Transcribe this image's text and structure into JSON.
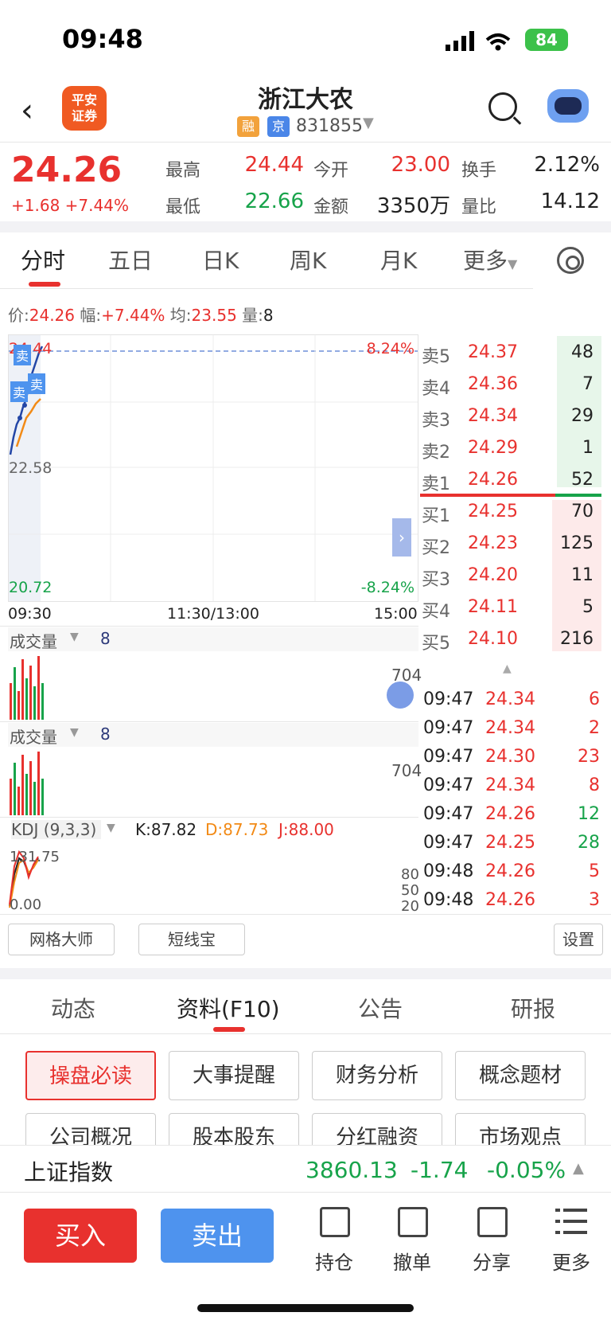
{
  "status": {
    "time": "09:48",
    "battery": "84"
  },
  "header": {
    "logo_line1": "平安",
    "logo_line2": "证券",
    "title": "浙江大农",
    "tag_rong": "融",
    "tag_jing": "京",
    "code": "831855"
  },
  "quote": {
    "price": "24.26",
    "change": "+1.68",
    "change_pct": "+7.44%",
    "high_label": "最高",
    "high": "24.44",
    "low_label": "最低",
    "low": "22.66",
    "open_label": "今开",
    "open": "23.00",
    "amount_label": "金额",
    "amount": "3350万",
    "turnover_label": "换手",
    "turnover": "2.12%",
    "ratio_label": "量比",
    "ratio": "14.12"
  },
  "tabs": [
    "分时",
    "五日",
    "日K",
    "周K",
    "月K",
    "更多"
  ],
  "infoline": {
    "price_label": "价:",
    "price": "24.26",
    "amp_label": "幅:",
    "amp": "+7.44%",
    "avg_label": "均:",
    "avg": "23.55",
    "vol_label": "量:",
    "vol": "8"
  },
  "chart": {
    "top_left": "24.44",
    "top_right": "8.24%",
    "mid_left": "22.58",
    "bottom_left": "20.72",
    "bottom_right": "-8.24%",
    "t_start": "09:30",
    "t_mid": "11:30/13:00",
    "t_end": "15:00",
    "sell_tag": "卖"
  },
  "order_book": {
    "asks": [
      {
        "label": "卖5",
        "price": "24.37",
        "vol": "48"
      },
      {
        "label": "卖4",
        "price": "24.36",
        "vol": "7"
      },
      {
        "label": "卖3",
        "price": "24.34",
        "vol": "29"
      },
      {
        "label": "卖2",
        "price": "24.29",
        "vol": "1"
      },
      {
        "label": "卖1",
        "price": "24.26",
        "vol": "52"
      }
    ],
    "bids": [
      {
        "label": "买1",
        "price": "24.25",
        "vol": "70"
      },
      {
        "label": "买2",
        "price": "24.23",
        "vol": "125"
      },
      {
        "label": "买3",
        "price": "24.20",
        "vol": "11"
      },
      {
        "label": "买4",
        "price": "24.11",
        "vol": "5"
      },
      {
        "label": "买5",
        "price": "24.10",
        "vol": "216"
      }
    ]
  },
  "ticks": [
    {
      "time": "09:47",
      "price": "24.34",
      "vol": "6",
      "dir": "up"
    },
    {
      "time": "09:47",
      "price": "24.34",
      "vol": "2",
      "dir": "up"
    },
    {
      "time": "09:47",
      "price": "24.30",
      "vol": "23",
      "dir": "up"
    },
    {
      "time": "09:47",
      "price": "24.34",
      "vol": "8",
      "dir": "up"
    },
    {
      "time": "09:47",
      "price": "24.26",
      "vol": "12",
      "dir": "down"
    },
    {
      "time": "09:47",
      "price": "24.25",
      "vol": "28",
      "dir": "down"
    },
    {
      "time": "09:48",
      "price": "24.26",
      "vol": "5",
      "dir": "up"
    },
    {
      "time": "09:48",
      "price": "24.26",
      "vol": "3",
      "dir": "up"
    }
  ],
  "volume1": {
    "label": "成交量",
    "value": "8",
    "max": "704"
  },
  "volume2": {
    "label": "成交量",
    "value": "8",
    "max": "704"
  },
  "kdj": {
    "label": "KDJ (9,3,3)",
    "k": "K:87.82",
    "d": "D:87.73",
    "j": "J:88.00",
    "top": "131.75",
    "bottom": "0.00",
    "l80": "80",
    "l50": "50",
    "l20": "20"
  },
  "tools": {
    "grid": "网格大师",
    "short": "短线宝",
    "settings": "设置"
  },
  "bottom_tabs": [
    "动态",
    "资料(F10)",
    "公告",
    "研报"
  ],
  "f10_buttons": [
    "操盘必读",
    "大事提醒",
    "财务分析",
    "概念题材",
    "公司概况",
    "股本股东",
    "分红融资",
    "市场观点"
  ],
  "index": {
    "name": "上证指数",
    "value": "3860.13",
    "change": "-1.74",
    "pct": "-0.05%"
  },
  "actions": {
    "buy": "买入",
    "sell": "卖出",
    "hold": "持仓",
    "cancel": "撤单",
    "share": "分享",
    "more": "更多"
  }
}
